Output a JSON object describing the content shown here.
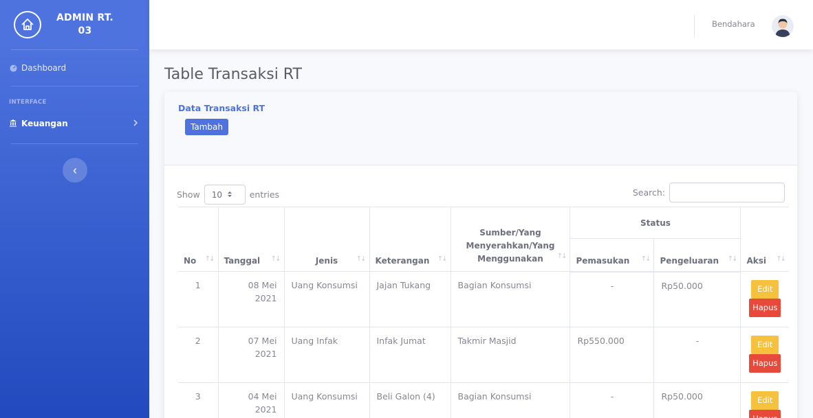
{
  "sidebar": {
    "brand_line1": "ADMIN RT.",
    "brand_line2": "03",
    "dashboard": "Dashboard",
    "heading": "INTERFACE",
    "keuangan": "Keuangan"
  },
  "topbar": {
    "user": "Bendahara"
  },
  "page_title": "Table Transaksi RT",
  "card": {
    "title": "Data Transaksi RT",
    "add_button": "Tambah",
    "show": "Show",
    "entries_value": "10",
    "entries": "entries",
    "search": "Search:"
  },
  "table": {
    "headers": {
      "no": "No",
      "tanggal": "Tanggal",
      "jenis": "Jenis",
      "keterangan": "Keterangan",
      "sumber": "Sumber/Yang Menyerahkan/Yang Menggunakan",
      "status": "Status",
      "pemasukan": "Pemasukan",
      "pengeluaran": "Pengeluaran",
      "aksi": "Aksi"
    },
    "rows": [
      {
        "no": "1",
        "tanggal": "08 Mei 2021",
        "jenis": "Uang Konsumsi",
        "keterangan": "Jajan Tukang",
        "sumber": "Bagian Konsumsi",
        "pemasukan": "-",
        "pengeluaran": "Rp50.000",
        "edit": "Edit",
        "hapus": "Hapus"
      },
      {
        "no": "2",
        "tanggal": "07 Mei 2021",
        "jenis": "Uang Infak",
        "keterangan": "Infak Jumat",
        "sumber": "Takmir Masjid",
        "pemasukan": "Rp550.000",
        "pengeluaran": "-",
        "edit": "Edit",
        "hapus": "Hapus"
      },
      {
        "no": "3",
        "tanggal": "04 Mei 2021",
        "jenis": "Uang Konsumsi",
        "keterangan": "Beli Galon (4)",
        "sumber": "Bagian Konsumsi",
        "pemasukan": "-",
        "pengeluaran": "Rp50.000",
        "edit": "Edit",
        "hapus": "Hapus"
      }
    ]
  },
  "colors": {
    "primary": "#4e73df",
    "warning": "#f6c23e",
    "danger": "#e74a3b"
  }
}
